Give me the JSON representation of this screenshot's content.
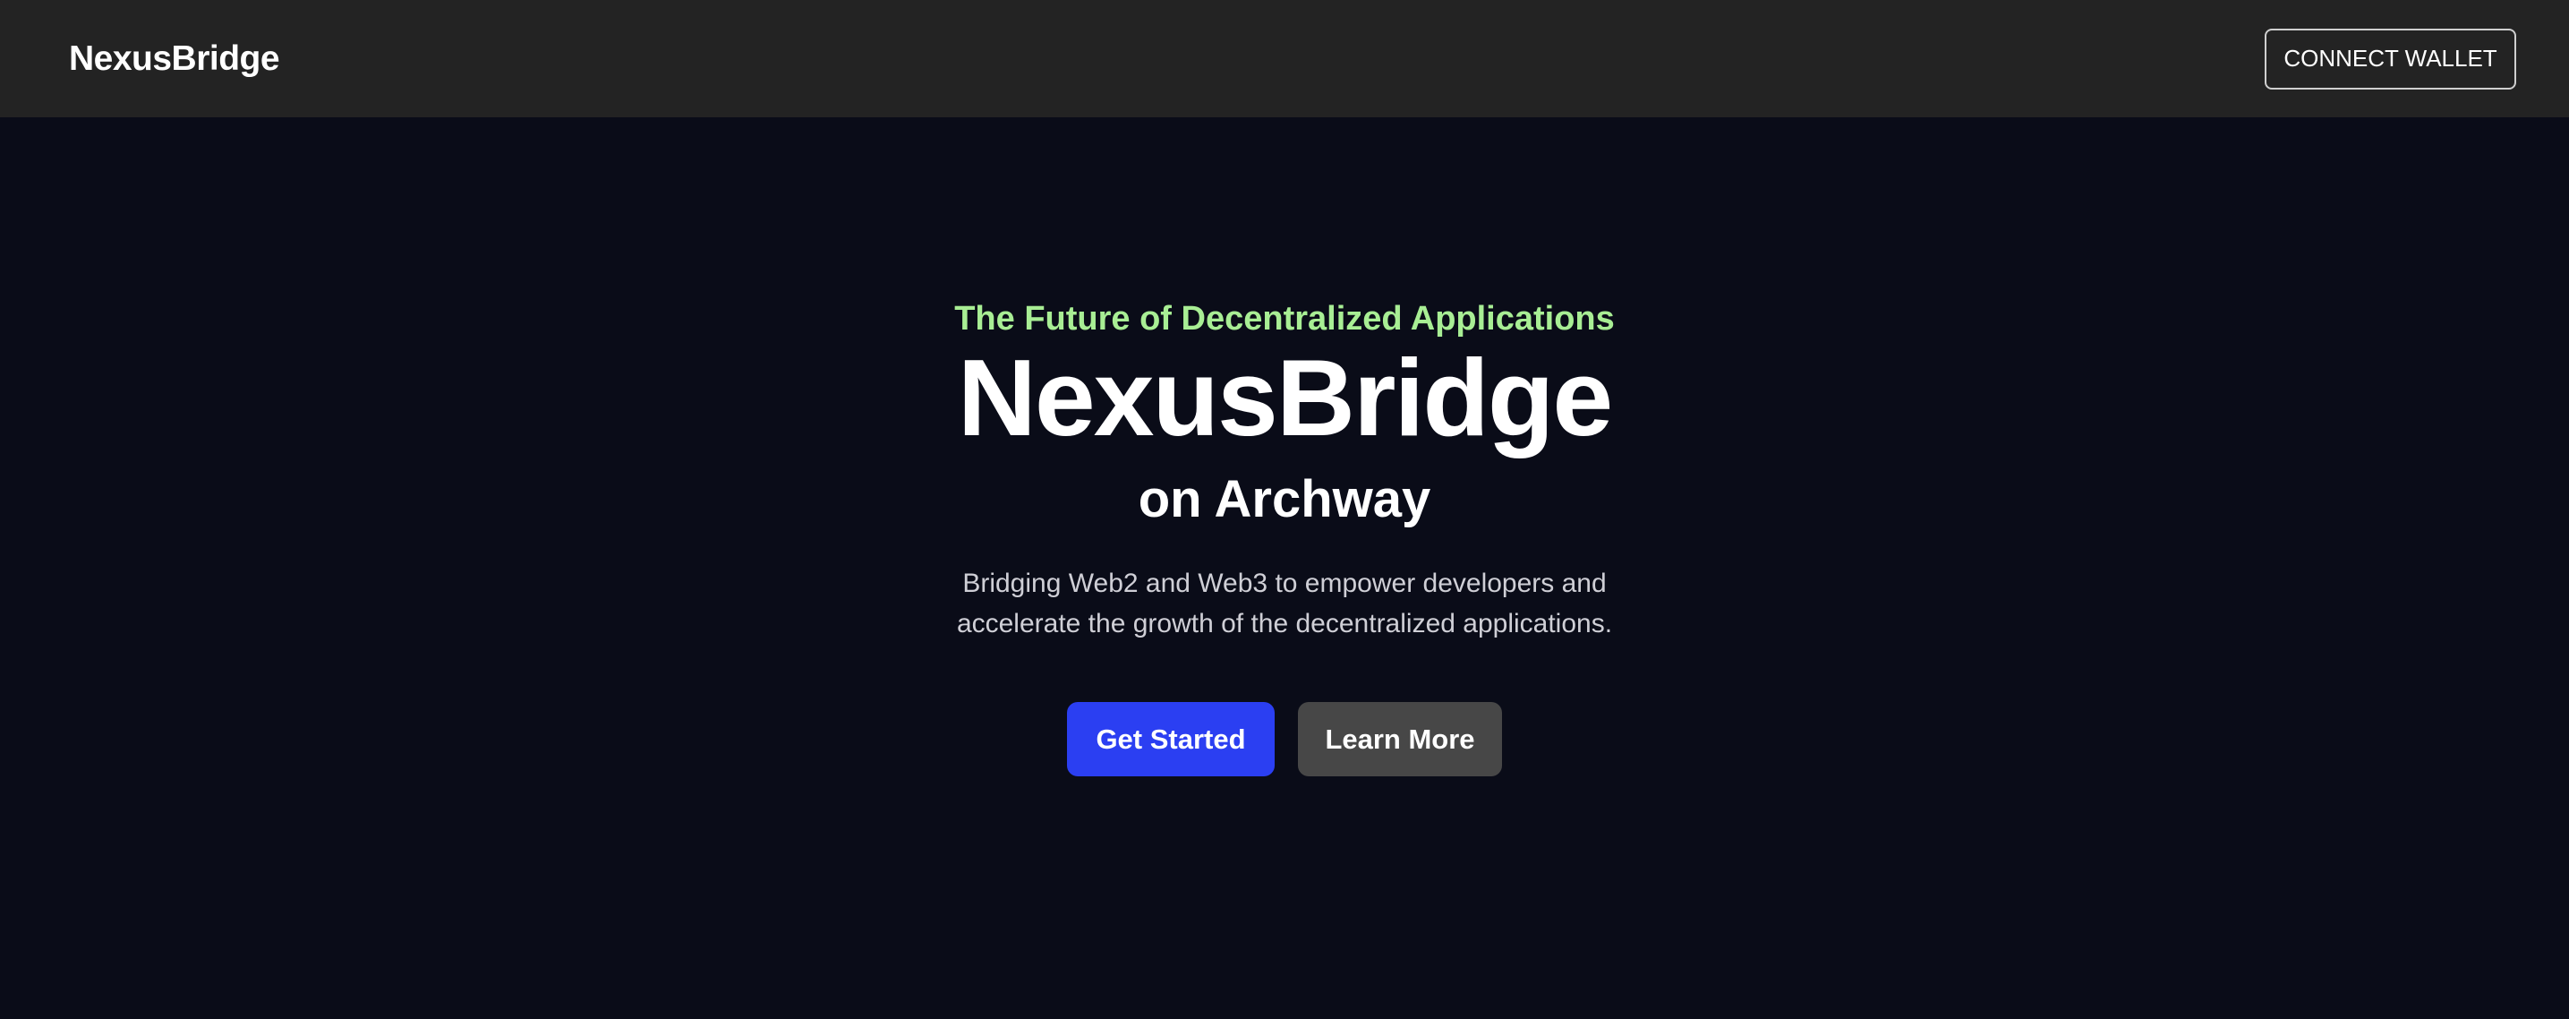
{
  "nav": {
    "brand": "NexusBridge",
    "connect_label": "CONNECT WALLET"
  },
  "hero": {
    "tagline": "The Future of Decentralized Applications",
    "title": "NexusBridge",
    "subtitle": "on Archway",
    "description_lines": [
      "Bridging Web2 and Web3 to empower developers and",
      "accelerate the growth of the decentralized applications."
    ],
    "primary_label": "Get Started",
    "secondary_label": "Learn More"
  },
  "colors": {
    "page_background": "#0a0c18",
    "navbar_background": "#232323",
    "tagline": "#a8ee94",
    "primary_button": "#2b3ff2",
    "secondary_button": "#474747"
  }
}
